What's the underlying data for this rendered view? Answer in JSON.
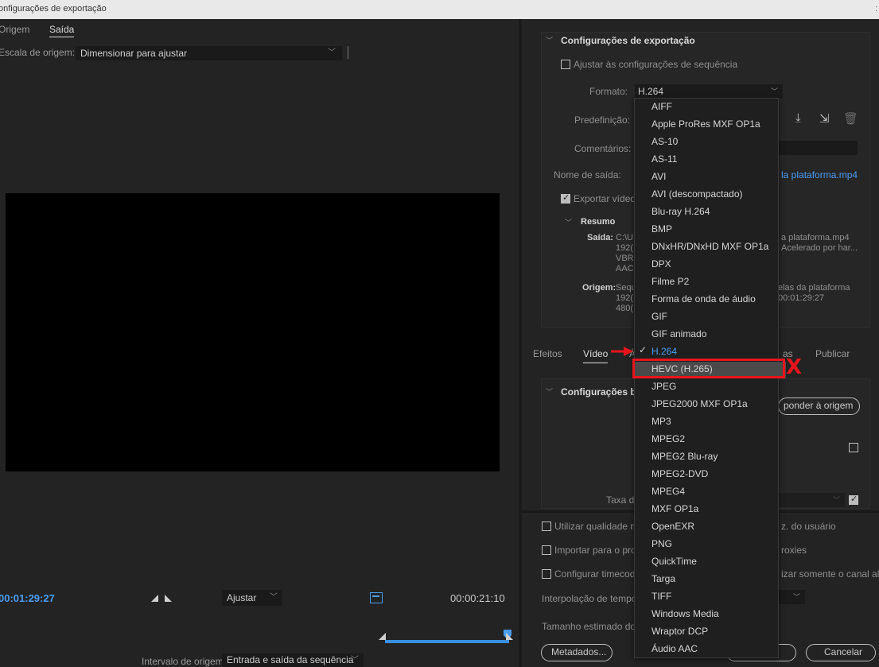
{
  "window": {
    "title": "onfigurações de exportação",
    "edge": ":"
  },
  "source_tabs": {
    "origin": "Origem",
    "output": "Saída"
  },
  "source_scaling": {
    "label": "Escala de origem:",
    "value": "Dimensionar para ajustar"
  },
  "playback": {
    "current_timecode": "00:01:29:27",
    "fit_label": "Ajustar",
    "duration_timecode": "00:00:21:10"
  },
  "range": {
    "label": "Intervalo de origem:",
    "value": "Entrada e saída da sequência"
  },
  "export_settings": {
    "title": "Configurações de exportação",
    "match_sequence": "Ajustar às configurações de sequência",
    "format_label": "Formato:",
    "format_value": "H.264",
    "preset_label": "Predefinição:",
    "comments_label": "Comentários:",
    "output_name_label": "Nome de saída:",
    "output_name_value": "la plataforma.mp4",
    "export_video": "Exportar vídeo",
    "summary_title": "Resumo",
    "output_key": "Saída:",
    "output_lines_left": [
      "C:\\U",
      "192(",
      "VBR,",
      "AAC,"
    ],
    "output_lines_right": [
      "a plataforma.mp4",
      "Acelerado por har..."
    ],
    "source_key": "Origem:",
    "source_lines_left": [
      "Sequ",
      "192(",
      "480("
    ],
    "source_lines_right": [
      "elas da plataforma",
      "00:01:29:27"
    ]
  },
  "bottom_tabs": {
    "effects": "Efeitos",
    "video": "Vídeo",
    "audio_partial": "Á",
    "captions_partial": "as",
    "publish": "Publicar"
  },
  "basic_settings": {
    "title": "Configurações bás",
    "match_source": "ponder à origem",
    "rate_label": "Taxa d"
  },
  "options": {
    "max_quality": "Utilizar qualidade m",
    "import_project": "Importar para o proj",
    "set_timecode": "Configurar timecode",
    "user_right": "z. do usuário",
    "proxies_right": "roxies",
    "alpha_right": "izar somente o canal alfa",
    "time_interp": "Interpolação de tempo:",
    "est_size": "Tamanho estimado do a"
  },
  "buttons": {
    "metadata": "Metadados...",
    "cancel": "Cancelar"
  },
  "format_dropdown": {
    "items": [
      "AIFF",
      "Apple ProRes MXF OP1a",
      "AS-10",
      "AS-11",
      "AVI",
      "AVI (descompactado)",
      "Blu-ray H.264",
      "BMP",
      "DNxHR/DNxHD MXF OP1a",
      "DPX",
      "Filme P2",
      "Forma de onda de áudio",
      "GIF",
      "GIF animado",
      "H.264",
      "HEVC (H.265)",
      "JPEG",
      "JPEG2000 MXF OP1a",
      "MP3",
      "MPEG2",
      "MPEG2 Blu-ray",
      "MPEG2-DVD",
      "MPEG4",
      "MXF OP1a",
      "OpenEXR",
      "PNG",
      "QuickTime",
      "Targa",
      "TIFF",
      "Windows Media",
      "Wraptor DCP",
      "Áudio AAC"
    ],
    "selected": "H.264",
    "highlighted": "HEVC (H.265)"
  },
  "annotation": {
    "mark": "X",
    "color": "#e8141c"
  },
  "colors": {
    "accent": "#4a9cf2",
    "background": "#232323"
  }
}
